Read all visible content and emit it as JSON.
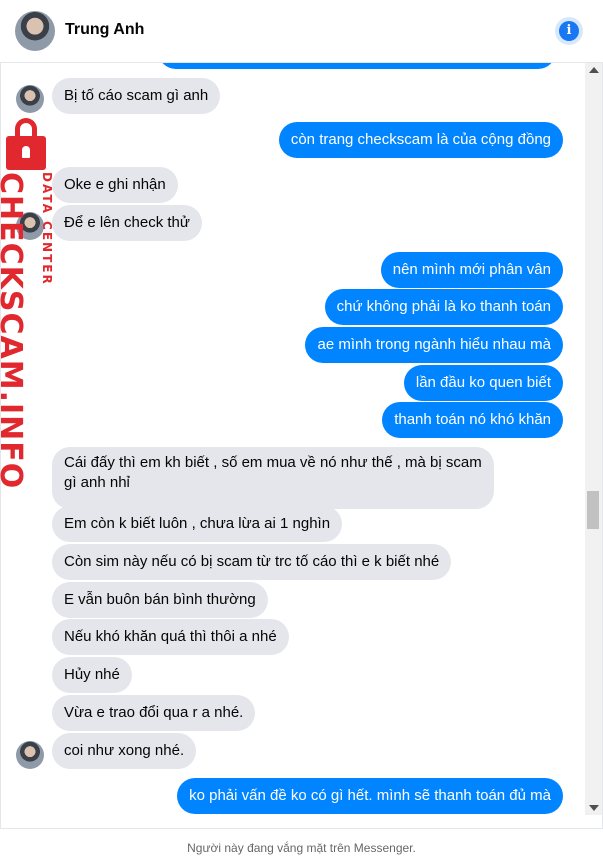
{
  "header": {
    "contact_name": "Trung Anh",
    "info_icon": "info-icon"
  },
  "messages": [
    {
      "from": "them",
      "text": "Bị tố cáo scam gì anh"
    },
    {
      "from": "me",
      "text": "còn trang checkscam là của cộng đồng"
    },
    {
      "from": "them",
      "text": "Oke e ghi nhận"
    },
    {
      "from": "them",
      "text": "Để e lên check thử"
    },
    {
      "from": "me",
      "text": "nên mình mới phân vân"
    },
    {
      "from": "me",
      "text": "chứ không phải là ko thanh toán"
    },
    {
      "from": "me",
      "text": "ae mình trong ngành hiểu nhau mà"
    },
    {
      "from": "me",
      "text": "lần đầu ko quen biết"
    },
    {
      "from": "me",
      "text": "thanh toán nó khó khăn"
    },
    {
      "from": "them",
      "text": "Cái đấy thì em kh biết , số em mua về nó như thế , mà bị scam gì anh nhỉ"
    },
    {
      "from": "them",
      "text": "Em còn k biết luôn , chưa lừa ai 1 nghìn"
    },
    {
      "from": "them",
      "text": "Còn sim này nếu có bị scam từ trc tố cáo thì e k biết nhé"
    },
    {
      "from": "them",
      "text": "E vẫn buôn bán bình thường"
    },
    {
      "from": "them",
      "text": "Nếu khó khăn quá thì thôi a nhé"
    },
    {
      "from": "them",
      "text": "Hủy nhé"
    },
    {
      "from": "them",
      "text": "Vừa e trao đổi qua r a nhé."
    },
    {
      "from": "them",
      "text": "coi như xong nhé."
    },
    {
      "from": "me",
      "text": "ko phải vấn đề ko có gì hết. mình sẽ thanh toán đủ mà"
    }
  ],
  "watermark": {
    "main": "CHECKSCAM.INFO",
    "sub": "DATA CENTER"
  },
  "footer": {
    "status_text": "Người này đang vắng mặt trên Messenger."
  },
  "colors": {
    "outgoing_bubble": "#0084ff",
    "incoming_bubble": "#e4e6eb",
    "watermark": "#e0282e"
  }
}
